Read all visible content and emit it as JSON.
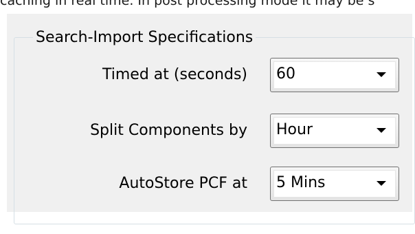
{
  "background_text": "caching in real time. In post processing mode it may be s",
  "group": {
    "title": "Search-Import Specifications",
    "rows": [
      {
        "label": "Timed at (seconds)",
        "value": "60",
        "icon": "chevron-down-icon"
      },
      {
        "label": "Split Components by",
        "value": "Hour",
        "icon": "chevron-down-icon"
      },
      {
        "label": "AutoStore PCF at",
        "value": "5 Mins",
        "icon": "chevron-down-icon"
      }
    ]
  },
  "colors": {
    "panel_background": "#f0f0f0",
    "group_border": "#d5dfe5",
    "combo_border": "#707070"
  }
}
